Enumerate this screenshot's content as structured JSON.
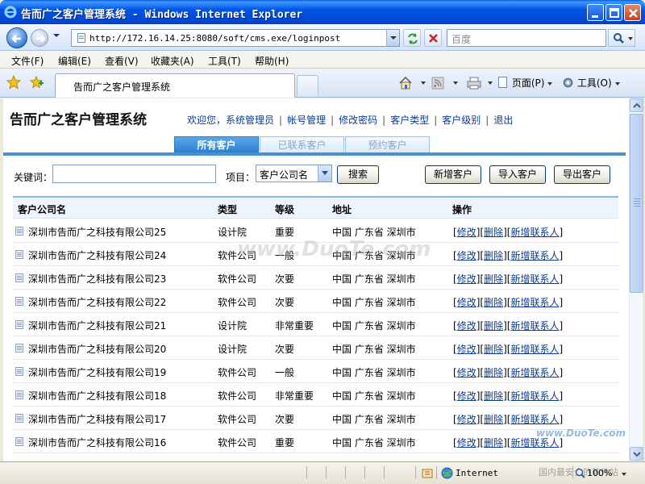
{
  "window": {
    "title": "告而广之客户管理系统 - Windows Internet Explorer"
  },
  "navbar": {
    "address": "http://172.16.14.25:8080/soft/cms.exe/loginpost",
    "search_placeholder": "百度"
  },
  "menubar": {
    "items": [
      "文件(F)",
      "编辑(E)",
      "查看(V)",
      "收藏夹(A)",
      "工具(T)",
      "帮助(H)"
    ]
  },
  "tabbar": {
    "active_tab": "告而广之客户管理系统",
    "page_label": "页面(P)",
    "tools_label": "工具(O)"
  },
  "app": {
    "title": "告而广之客户管理系统",
    "links": [
      "欢迎您，系统管理员",
      "帐号管理",
      "修改密码",
      "客户类型",
      "客户级别",
      "退出"
    ],
    "tabs": [
      "所有客户",
      "已联系客户",
      "预约客户"
    ],
    "active_tab_index": 0
  },
  "filter": {
    "keyword_label": "关键词：",
    "keyword_value": "",
    "field_label": "项目：",
    "field_selected": "客户公司名",
    "search_btn": "搜索",
    "new_btn": "新增客户",
    "import_btn": "导入客户",
    "export_btn": "导出客户"
  },
  "table": {
    "headers": [
      "客户公司名",
      "类型",
      "等级",
      "地址",
      "操作"
    ],
    "rows": [
      {
        "name": "深圳市告而广之科技有限公司25",
        "type": "设计院",
        "level": "重要",
        "address": "中国 广东省 深圳市"
      },
      {
        "name": "深圳市告而广之科技有限公司24",
        "type": "软件公司",
        "level": "一般",
        "address": "中国 广东省 深圳市"
      },
      {
        "name": "深圳市告而广之科技有限公司23",
        "type": "软件公司",
        "level": "次要",
        "address": "中国 广东省 深圳市"
      },
      {
        "name": "深圳市告而广之科技有限公司22",
        "type": "软件公司",
        "level": "次要",
        "address": "中国 广东省 深圳市"
      },
      {
        "name": "深圳市告而广之科技有限公司21",
        "type": "设计院",
        "level": "非常重要",
        "address": "中国 广东省 深圳市"
      },
      {
        "name": "深圳市告而广之科技有限公司20",
        "type": "设计院",
        "level": "次要",
        "address": "中国 广东省 深圳市"
      },
      {
        "name": "深圳市告而广之科技有限公司19",
        "type": "软件公司",
        "level": "一般",
        "address": "中国 广东省 深圳市"
      },
      {
        "name": "深圳市告而广之科技有限公司18",
        "type": "软件公司",
        "level": "非常重要",
        "address": "中国 广东省 深圳市"
      },
      {
        "name": "深圳市告而广之科技有限公司17",
        "type": "软件公司",
        "level": "次要",
        "address": "中国 广东省 深圳市"
      },
      {
        "name": "深圳市告而广之科技有限公司16",
        "type": "软件公司",
        "level": "重要",
        "address": "中国 广东省 深圳市"
      }
    ],
    "ops": {
      "edit": "修改",
      "delete": "删除",
      "add_contact": "新增联系人"
    }
  },
  "watermarks": {
    "center": "www.DuoTe.com",
    "corner": "www.DuoTe.com",
    "status": "国内最安全的软件站"
  },
  "statusbar": {
    "zone": "Internet",
    "zoom": "100%"
  },
  "colors": {
    "titlebar": "#0055e5",
    "tab_active": "#2d7fd0",
    "link": "#0a3b8c"
  }
}
